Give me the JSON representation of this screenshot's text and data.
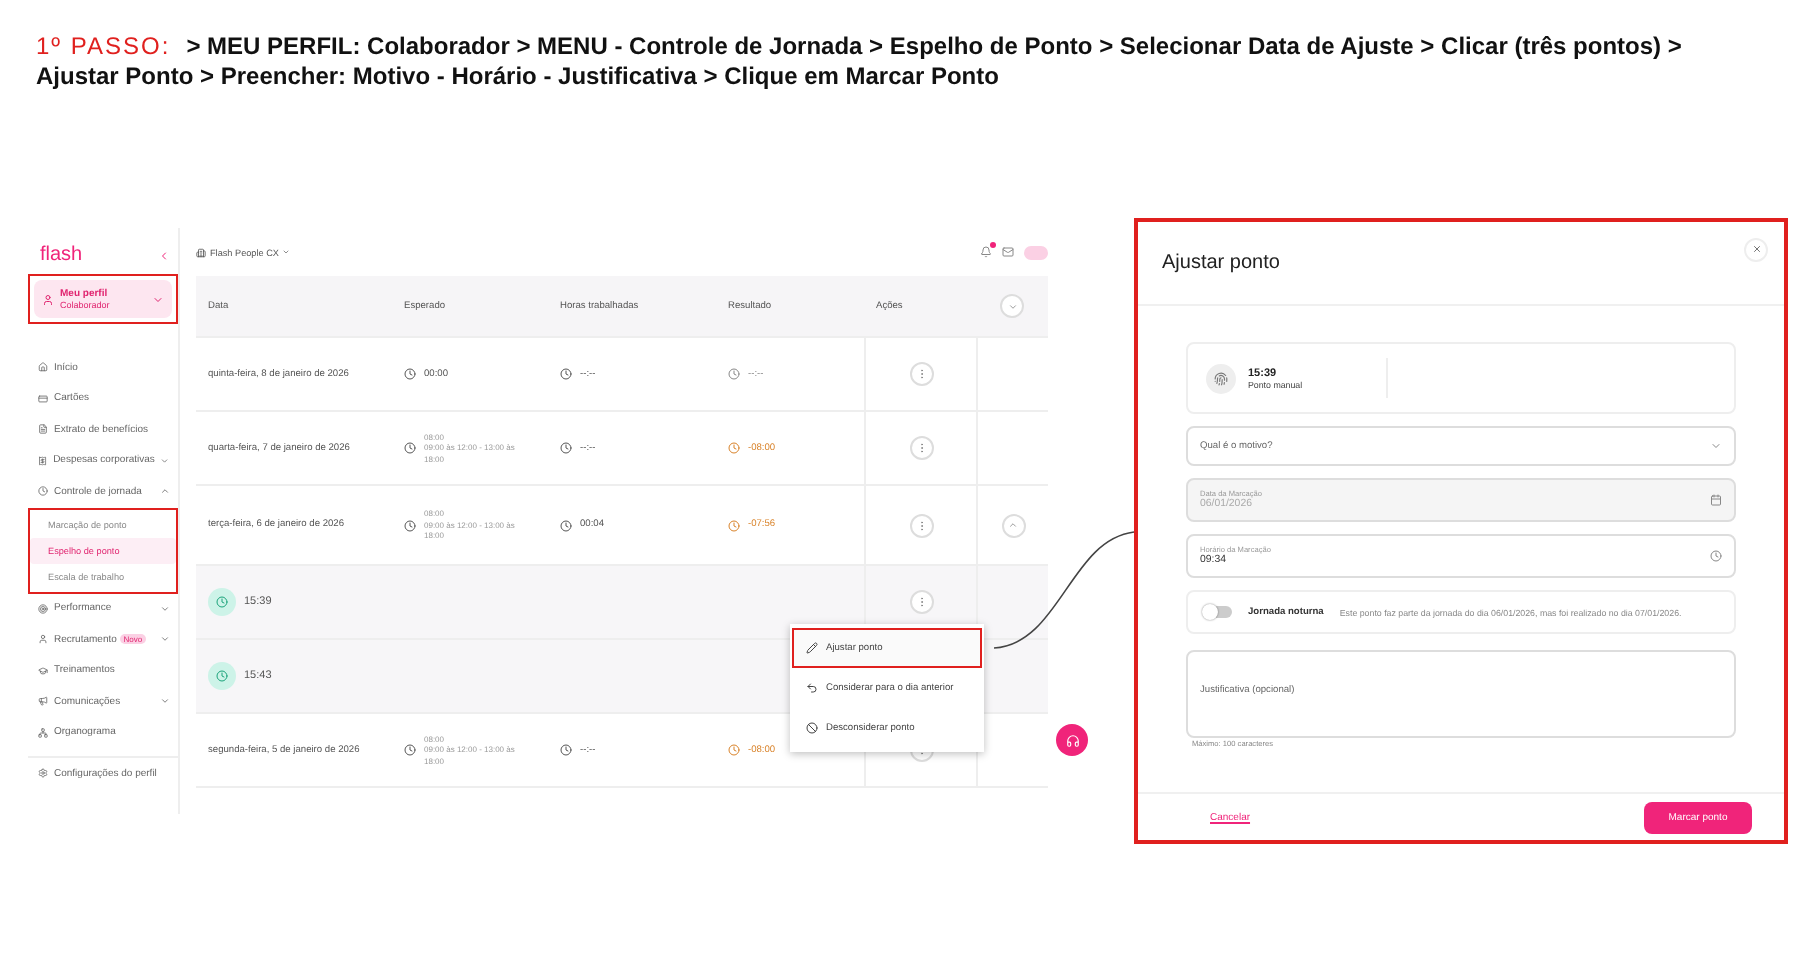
{
  "instruction": {
    "step": "1º PASSO:",
    "text": "> MEU PERFIL: Colaborador > MENU - Controle de Jornada > Espelho de Ponto > Selecionar Data de Ajuste > Clicar (três pontos) > Ajustar Ponto > Preencher: Motivo - Horário - Justificativa > Clique em Marcar Ponto"
  },
  "app": {
    "sidebar": {
      "logo": "flash",
      "profile": {
        "name": "Meu perfil",
        "role": "Colaborador",
        "highlighted": true
      },
      "items": [
        {
          "label": "Início",
          "kind": "link"
        },
        {
          "label": "Cartões",
          "kind": "link"
        },
        {
          "label": "Extrato de benefícios",
          "kind": "link"
        },
        {
          "label": "Despesas corporativas",
          "kind": "group",
          "expanded": false
        },
        {
          "label": "Controle de jornada",
          "kind": "group",
          "expanded": true,
          "children_highlighted": true,
          "children": [
            {
              "label": "Marcação de ponto",
              "selected": false
            },
            {
              "label": "Espelho de ponto",
              "selected": true
            },
            {
              "label": "Escala de trabalho",
              "selected": false
            }
          ]
        },
        {
          "label": "Performance",
          "kind": "group",
          "expanded": false
        },
        {
          "label": "Recrutamento",
          "kind": "group",
          "expanded": false,
          "badge": "Novo"
        },
        {
          "label": "Treinamentos",
          "kind": "link"
        },
        {
          "label": "Comunicações",
          "kind": "group",
          "expanded": false
        },
        {
          "label": "Organograma",
          "kind": "link"
        }
      ],
      "footer_item": "Configurações do perfil"
    },
    "topbar": {
      "company": "Flash People CX",
      "notifications": true
    },
    "table": {
      "columns": [
        "Data",
        "Esperado",
        "Horas trabalhadas",
        "Resultado",
        "Ações"
      ],
      "rows": [
        {
          "kind": "day",
          "date": "quinta-feira, 8 de janeiro de 2026",
          "expected": "00:00",
          "worked": "--:--",
          "result": "--:--",
          "negative": false
        },
        {
          "kind": "day",
          "date": "quarta-feira, 7 de janeiro de 2026",
          "expected": "08:00",
          "schedule": "09:00 às 12:00 - 13:00 às 18:00",
          "worked": "--:--",
          "result": "-08:00",
          "negative": true
        },
        {
          "kind": "day",
          "date": "terça-feira, 6 de janeiro de 2026",
          "expected": "08:00",
          "schedule": "09:00 às 12:00 - 13:00 às 18:00",
          "worked": "00:04",
          "result": "-07:56",
          "negative": true,
          "expanded": true
        },
        {
          "kind": "punch",
          "time": "15:39"
        },
        {
          "kind": "punch",
          "time": "15:43"
        },
        {
          "kind": "day",
          "date": "segunda-feira, 5 de janeiro de 2026",
          "expected": "08:00",
          "schedule": "09:00 às 12:00 - 13:00 às 18:00",
          "worked": "--:--",
          "result": "-08:00",
          "negative": true
        }
      ]
    },
    "menu": [
      {
        "label": "Ajustar ponto",
        "highlighted": true
      },
      {
        "label": "Considerar para o dia anterior",
        "highlighted": false
      },
      {
        "label": "Desconsiderar ponto",
        "highlighted": false
      }
    ]
  },
  "modal": {
    "title": "Ajustar ponto",
    "punch": {
      "time": "15:39",
      "type": "Ponto manual"
    },
    "reason": {
      "placeholder": "Qual é o motivo?"
    },
    "date": {
      "label": "Data da Marcação",
      "value": "06/01/2026",
      "disabled": true
    },
    "time": {
      "label": "Horário da Marcação",
      "value": "09:34",
      "disabled": false
    },
    "night": {
      "label": "Jornada noturna",
      "on": false,
      "note": "Este ponto faz parte da jornada do dia 06/01/2026, mas foi realizado no dia 07/01/2026."
    },
    "justification": {
      "placeholder": "Justificativa (opcional)",
      "helper": "Máximo: 100 caracteres"
    },
    "cancel": "Cancelar",
    "submit": "Marcar ponto"
  }
}
